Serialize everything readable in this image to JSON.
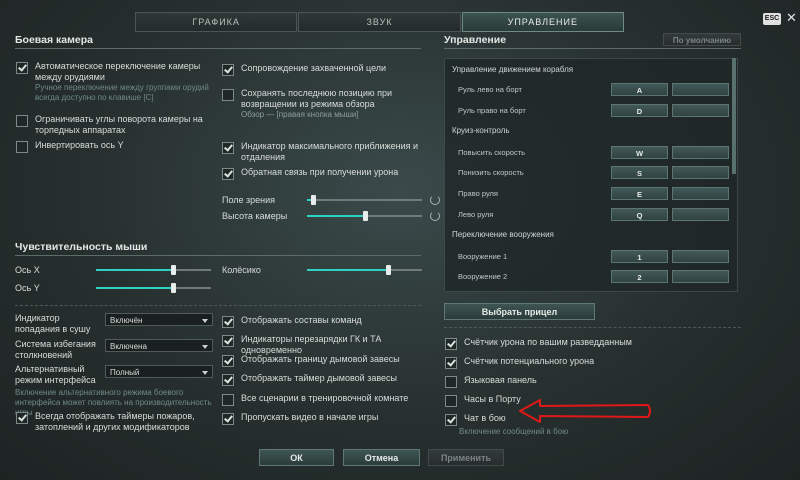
{
  "tabs": [
    {
      "label": "ГРАФИКА",
      "active": false
    },
    {
      "label": "ЗВУК",
      "active": false
    },
    {
      "label": "УПРАВЛЕНИЕ",
      "active": true
    }
  ],
  "esc_label": "ESC",
  "close_glyph": "✕",
  "battle_camera": {
    "title": "Боевая камера",
    "left": [
      {
        "label": "Автоматическое переключение камеры между орудиями",
        "checked": true,
        "sub": "Ручное переключение между группами орудий всегда доступно по клавише [C]"
      },
      {
        "label": "Ограничивать углы поворота камеры на торпедных аппаратах",
        "checked": false
      },
      {
        "label": "Инвертировать ось Y",
        "checked": false
      }
    ],
    "right": [
      {
        "label": "Сопровождение захваченной цели",
        "checked": true
      },
      {
        "label": "Сохранять последнюю позицию при возвращении из режима обзора",
        "checked": false,
        "sub": "Обзор — [правая кнопка мыши]"
      },
      {
        "label": "Индикатор максимального приближения и отдаления",
        "checked": true
      },
      {
        "label": "Обратная связь при получении урона",
        "checked": true
      }
    ],
    "sliders": [
      {
        "label": "Поле зрения",
        "value": 0.05
      },
      {
        "label": "Высота камеры",
        "value": 0.5
      }
    ]
  },
  "mouse": {
    "title": "Чувствительность мыши",
    "axis_x": {
      "label": "Ось X",
      "value": 0.67
    },
    "axis_y": {
      "label": "Ось Y",
      "value": 0.67
    },
    "wheel": {
      "label": "Колёсико",
      "value": 0.7
    }
  },
  "interface": {
    "dropdowns": [
      {
        "label": "Индикатор попадания в сушу",
        "value": "Включён"
      },
      {
        "label": "Система избегания столкновений",
        "value": "Включена"
      },
      {
        "label": "Альтернативный режим интерфейса",
        "value": "Полный"
      }
    ],
    "alt_note": "Включение альтернативного режима боевого интерфейса может повлиять на производительность игры",
    "timers": {
      "label": "Всегда отображать таймеры пожаров, затоплений и других модификаторов",
      "checked": true
    },
    "middle": [
      {
        "label": "Отображать составы команд",
        "checked": true
      },
      {
        "label": "Индикаторы перезарядки ГК и ТА одновременно",
        "checked": true
      },
      {
        "label": "Отображать границу дымовой завесы",
        "checked": true
      },
      {
        "label": "Отображать таймер дымовой завесы",
        "checked": true
      },
      {
        "label": "Все сценарии в тренировочной комнате",
        "checked": false
      },
      {
        "label": "Пропускать видео в начале игры",
        "checked": true
      }
    ]
  },
  "controls": {
    "title": "Управление",
    "default_button": "По умолчанию",
    "groups": [
      {
        "title": "Управление движением корабля",
        "rows": [
          {
            "label": "Руль лево на борт",
            "key": "A"
          },
          {
            "label": "Руль право на борт",
            "key": "D"
          }
        ]
      },
      {
        "title": "Круиз-контроль",
        "rows": [
          {
            "label": "Повысить скорость",
            "key": "W"
          },
          {
            "label": "Понизить скорость",
            "key": "S"
          },
          {
            "label": "Право руля",
            "key": "E"
          },
          {
            "label": "Лево руля",
            "key": "Q"
          }
        ]
      },
      {
        "title": "Переключение вооружения",
        "rows": [
          {
            "label": "Вооружение 1",
            "key": "1"
          },
          {
            "label": "Вооружение 2",
            "key": "2"
          }
        ]
      }
    ],
    "scope_button": "Выбрать прицел",
    "checks": [
      {
        "label": "Счётчик урона по вашим разведданным",
        "checked": true
      },
      {
        "label": "Счётчик потенциального урона",
        "checked": true
      },
      {
        "label": "Языковая панель",
        "checked": false
      },
      {
        "label": "Часы в Порту",
        "checked": false
      },
      {
        "label": "Чат в бою",
        "checked": true
      }
    ],
    "chat_sub": "Включение сообщений в бою"
  },
  "footer": {
    "ok": "ОК",
    "cancel": "Отмена",
    "apply": "Применить"
  },
  "colors": {
    "accent": "#2fd1c3",
    "arrow": "#e01818"
  }
}
